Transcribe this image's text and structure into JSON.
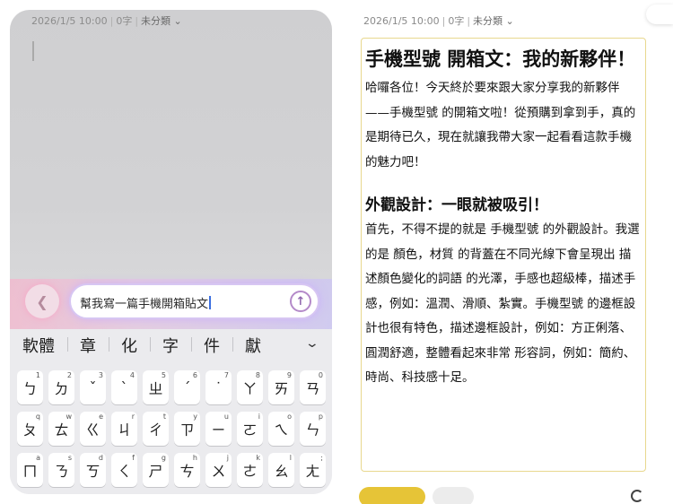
{
  "left": {
    "meta": {
      "date": "2026/1/5 10:00",
      "chars": "0字",
      "category": "未分類"
    },
    "ai_prompt": {
      "text": "幫我寫一篇手機開箱貼文"
    },
    "keyboard": {
      "candidates": [
        "軟體",
        "章",
        "化",
        "字",
        "件",
        "獻"
      ],
      "rows": [
        [
          {
            "k": "ㄅ",
            "s": "1"
          },
          {
            "k": "ㄉ",
            "s": "2"
          },
          {
            "k": "ˇ",
            "s": "3"
          },
          {
            "k": "ˋ",
            "s": "4"
          },
          {
            "k": "ㄓ",
            "s": "5"
          },
          {
            "k": "ˊ",
            "s": "6"
          },
          {
            "k": "˙",
            "s": "7"
          },
          {
            "k": "ㄚ",
            "s": "8"
          },
          {
            "k": "ㄞ",
            "s": "9"
          },
          {
            "k": "ㄢ",
            "s": "0"
          }
        ],
        [
          {
            "k": "ㄆ",
            "s": "q"
          },
          {
            "k": "ㄊ",
            "s": "w"
          },
          {
            "k": "ㄍ",
            "s": "e"
          },
          {
            "k": "ㄐ",
            "s": "r"
          },
          {
            "k": "ㄔ",
            "s": "t"
          },
          {
            "k": "ㄗ",
            "s": "y"
          },
          {
            "k": "ㄧ",
            "s": "u"
          },
          {
            "k": "ㄛ",
            "s": "i"
          },
          {
            "k": "ㄟ",
            "s": "o"
          },
          {
            "k": "ㄣ",
            "s": "p"
          }
        ],
        [
          {
            "k": "ㄇ",
            "s": "a"
          },
          {
            "k": "ㄋ",
            "s": "s"
          },
          {
            "k": "ㄎ",
            "s": "d"
          },
          {
            "k": "ㄑ",
            "s": "f"
          },
          {
            "k": "ㄕ",
            "s": "g"
          },
          {
            "k": "ㄘ",
            "s": "h"
          },
          {
            "k": "ㄨ",
            "s": "j"
          },
          {
            "k": "ㄜ",
            "s": "k"
          },
          {
            "k": "ㄠ",
            "s": "l"
          },
          {
            "k": "ㄤ",
            "s": ";"
          }
        ]
      ]
    }
  },
  "right": {
    "meta": {
      "date": "2026/1/5 10:00",
      "chars": "0字",
      "category": "未分類"
    },
    "doc": {
      "title": "手機型號 開箱文：我的新夥伴！",
      "intro": "哈囉各位！今天終於要來跟大家分享我的新夥伴——手機型號 的開箱文啦！從預購到拿到手，真的是期待已久，現在就讓我帶大家一起看看這款手機的魅力吧！",
      "section_title": "外觀設計：一眼就被吸引！",
      "section_body": "首先，不得不提的就是 手機型號 的外觀設計。我選的是 顏色，材質 的背蓋在不同光線下會呈現出 描述顏色變化的詞語 的光澤，手感也超級棒，描述手感，例如：溫潤、滑順、紮實。手機型號 的邊框設計也很有特色，描述邊框設計，例如：方正俐落、圓潤舒適，整體看起來非常 形容詞，例如：簡約、時尚、科技感十足。"
    }
  }
}
